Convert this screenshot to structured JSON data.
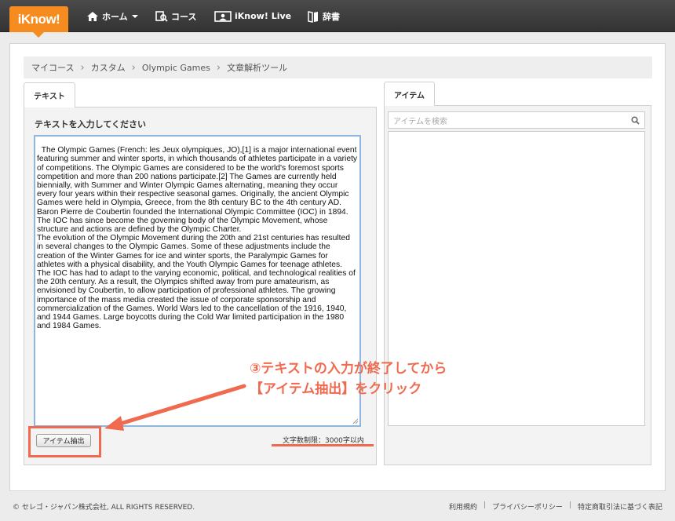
{
  "nav": {
    "logo": "iKnow!",
    "home": "ホーム",
    "course": "コース",
    "live": "iKnow! Live",
    "dict": "辞書"
  },
  "breadcrumb": {
    "items": [
      "マイコース",
      "カスタム",
      "Olympic Games",
      "文章解析ツール"
    ]
  },
  "text_pane": {
    "tab": "テキスト",
    "label": "テキストを入力してください",
    "content": "The Olympic Games (French: les Jeux olympiques, JO),[1] is a major international event featuring summer and winter sports, in which thousands of athletes participate in a variety of competitions. The Olympic Games are considered to be the world's foremost sports competition and more than 200 nations participate.[2] The Games are currently held biennially, with Summer and Winter Olympic Games alternating, meaning they occur every four years within their respective seasonal games. Originally, the ancient Olympic Games were held in Olympia, Greece, from the 8th century BC to the 4th century AD. Baron Pierre de Coubertin founded the International Olympic Committee (IOC) in 1894. The IOC has since become the governing body of the Olympic Movement, whose structure and actions are defined by the Olympic Charter.\nThe evolution of the Olympic Movement during the 20th and 21st centuries has resulted in several changes to the Olympic Games. Some of these adjustments include the creation of the Winter Games for ice and winter sports, the Paralympic Games for athletes with a physical disability, and the Youth Olympic Games for teenage athletes. The IOC has had to adapt to the varying economic, political, and technological realities of the 20th century. As a result, the Olympics shifted away from pure amateurism, as envisioned by Coubertin, to allow participation of professional athletes. The growing importance of the mass media created the issue of corporate sponsorship and commercialization of the Games. World Wars led to the cancellation of the 1916, 1940, and 1944 Games. Large boycotts during the Cold War limited participation in the 1980 and 1984 Games.",
    "extract_button": "アイテム抽出",
    "char_limit": "文字数制限：3000字以内"
  },
  "item_pane": {
    "tab": "アイテム",
    "search_placeholder": "アイテムを検索"
  },
  "annotation": {
    "line1": "③テキストの入力が終了してから",
    "line2": "【アイテム抽出】をクリック"
  },
  "footer": {
    "copyright": "© セレゴ・ジャパン株式会社, ALL RIGHTS RESERVED.",
    "links": [
      "利用規約",
      "プライバシーポリシー",
      "特定商取引法に基づく表記"
    ]
  },
  "colors": {
    "accent": "#f68b1f",
    "annotation": "#f06a4f",
    "topbar": "#3a3a3a"
  }
}
